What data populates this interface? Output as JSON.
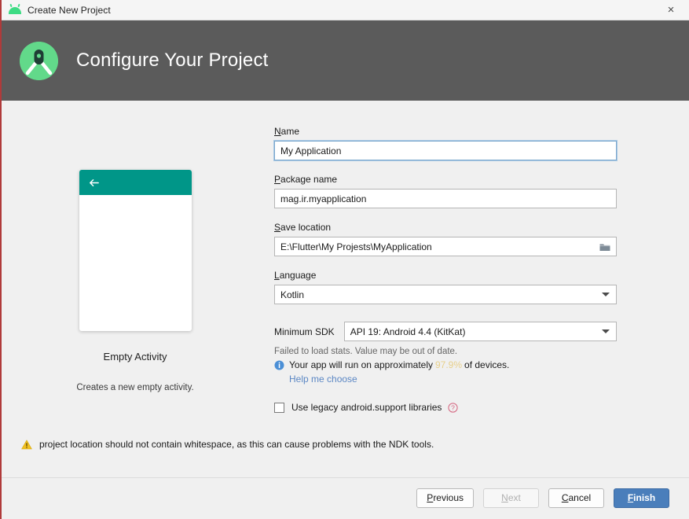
{
  "window": {
    "title": "Create New Project",
    "icon": "android-head-icon",
    "close_label": "×"
  },
  "header": {
    "title": "Configure Your Project",
    "logo": "android-studio-logo",
    "background": "#5b5b5b"
  },
  "preview": {
    "appbar_color": "#009688",
    "back_icon": "arrow-left-icon",
    "name": "Empty Activity",
    "description": "Creates a new empty activity."
  },
  "form": {
    "name": {
      "label": "Name",
      "mnemonic": "N",
      "value": "My Application",
      "focused": true
    },
    "package_name": {
      "label": "Package name",
      "mnemonic": "P",
      "value": "mag.ir.myapplication"
    },
    "save_location": {
      "label": "Save location",
      "mnemonic": "S",
      "value": "E:\\Flutter\\My Projests\\MyApplication",
      "browse_icon": "folder-icon"
    },
    "language": {
      "label": "Language",
      "mnemonic": "L",
      "value": "Kotlin",
      "caret_icon": "chevron-down-icon"
    },
    "minimum_sdk": {
      "label": "Minimum SDK",
      "value": "API 19: Android 4.4 (KitKat)",
      "caret_icon": "chevron-down-icon"
    },
    "stats": {
      "failed_text": "Failed to load stats. Value may be out of date.",
      "info_icon": "info-icon",
      "prefix": "Your app will run on approximately",
      "percent": "97.9%",
      "percent_color": "#e8d08a",
      "suffix": "of devices.",
      "help_link": "Help me choose"
    },
    "legacy_checkbox": {
      "label": "Use legacy android.support libraries",
      "checked": false,
      "help_icon": "question-mark-icon"
    }
  },
  "warning": {
    "icon": "warning-triangle-icon",
    "text": "project location should not contain whitespace, as this can cause problems with the NDK tools."
  },
  "footer": {
    "previous": {
      "label": "Previous",
      "mnemonic": "P",
      "enabled": true
    },
    "next": {
      "label": "Next",
      "mnemonic": "N",
      "enabled": false
    },
    "cancel": {
      "label": "Cancel",
      "mnemonic": "C",
      "enabled": true
    },
    "finish": {
      "label": "Finish",
      "mnemonic": "F",
      "enabled": true,
      "color": "#4a7ebb"
    }
  }
}
